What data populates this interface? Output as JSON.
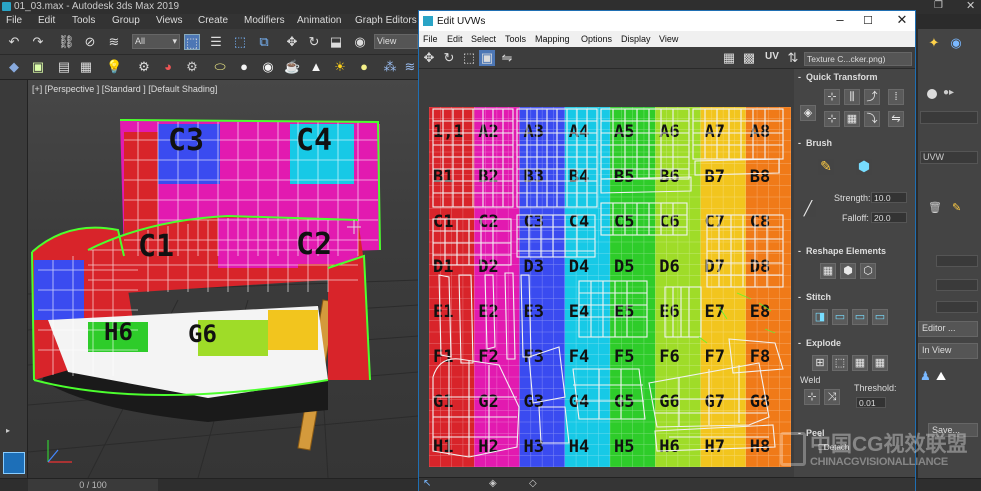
{
  "app": {
    "title": "01_03.max - Autodesk 3ds Max 2019",
    "menu": [
      "File",
      "Edit",
      "Tools",
      "Group",
      "Views",
      "Create",
      "Modifiers",
      "Animation",
      "Graph Editors"
    ],
    "selection_filter": "All",
    "view_dropdown": "View"
  },
  "viewport": {
    "label": "[+] [Perspective ] [Standard ] [Default Shading]"
  },
  "status": {
    "frames": "0 / 100"
  },
  "command_panel": {
    "modifier_item": "UVW",
    "editor_button": "Editor ...",
    "in_view_button": "In View",
    "save_button": "Save..."
  },
  "uvw_window": {
    "title": "Edit UVWs",
    "menu": [
      "File",
      "Edit",
      "Select",
      "Tools",
      "Mapping",
      "Options",
      "Display",
      "View"
    ],
    "uv_label": "UV",
    "texture_dropdown": "Texture C...cker.png)",
    "canvas_labels": [
      "1,1",
      "A2",
      "A3",
      "A4",
      "A5",
      "A6",
      "A7",
      "A8",
      "B1",
      "B2",
      "B3",
      "B4",
      "B5",
      "B6",
      "B7",
      "B8",
      "C1",
      "C2",
      "C3",
      "C4",
      "C5",
      "C6",
      "C7",
      "C8",
      "D1",
      "D2",
      "D3",
      "D4",
      "D5",
      "D6",
      "D7",
      "D8",
      "E1",
      "E2",
      "E3",
      "E4",
      "E5",
      "E6",
      "E7",
      "E8",
      "F1",
      "F2",
      "F3",
      "F4",
      "F5",
      "F6",
      "F7",
      "F8",
      "G1",
      "G2",
      "G3",
      "G4",
      "G5",
      "G6",
      "G7",
      "G8",
      "H1",
      "H2",
      "H3",
      "H4",
      "H5",
      "H6",
      "H7",
      "H8"
    ]
  },
  "uvw_panel": {
    "quick_transform": "Quick Transform",
    "brush": "Brush",
    "strength_label": "Strength:",
    "strength_value": "10.0",
    "falloff_label": "Falloff:",
    "falloff_value": "20.0",
    "reshape": "Reshape Elements",
    "stitch": "Stitch",
    "explode": "Explode",
    "weld_label": "Weld",
    "threshold_label": "Threshold:",
    "threshold_value": "0.01",
    "peel": "Peel",
    "detach_label": "Detach"
  },
  "watermark": {
    "cn": "中国CG视效联盟",
    "en": "CHINACGVISIONALLIANCE"
  },
  "colors": {
    "checker": [
      "#d8242a",
      "#e21ab0",
      "#3a4bf0",
      "#17c9e6",
      "#2ecc2a",
      "#9fdc28",
      "#f2c51e",
      "#f07a18"
    ],
    "uv_wire": "#f2f2f2",
    "selection_outline": "#4cff2e",
    "chair_legs": "#d49a3c"
  }
}
